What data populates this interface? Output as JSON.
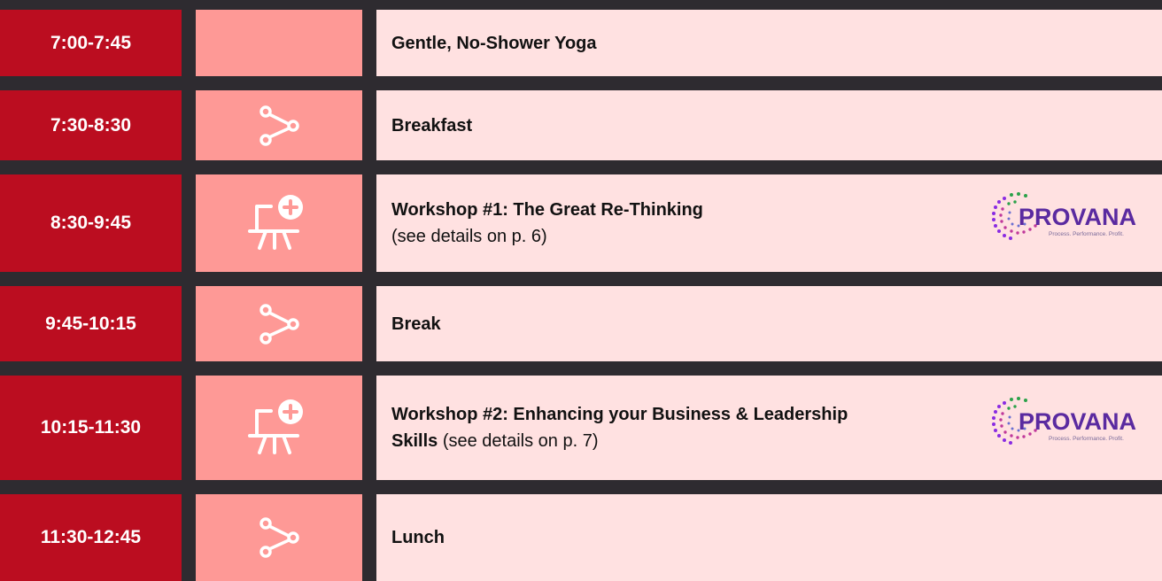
{
  "schedule": {
    "rows": [
      {
        "time": "7:00-7:45",
        "icon": "none",
        "title": "Gentle, No-Shower Yoga",
        "detail": ""
      },
      {
        "time": "7:30-8:30",
        "icon": "share-icon",
        "title": "Breakfast",
        "detail": ""
      },
      {
        "time": "8:30-9:45",
        "icon": "presentation-add-icon",
        "title": "Workshop #1: The Great Re-Thinking",
        "detail": "(see details on p. 6)"
      },
      {
        "time": "9:45-10:15",
        "icon": "share-icon",
        "title": "Break",
        "detail": ""
      },
      {
        "time": "10:15-11:30",
        "icon": "presentation-add-icon",
        "title": "Workshop #2: Enhancing your Business & Leadership Skills",
        "detail": "(see details on p. 7)"
      },
      {
        "time": "11:30-12:45",
        "icon": "share-icon",
        "title": "Lunch",
        "detail": ""
      }
    ],
    "sponsor": {
      "name": "PROVANA",
      "tagline": "Process. Performance. Profit."
    }
  },
  "colors": {
    "background": "#2e2b30",
    "time_cell": "#bb0d20",
    "icon_cell": "#fe9996",
    "description_cell": "#ffe1e1"
  }
}
